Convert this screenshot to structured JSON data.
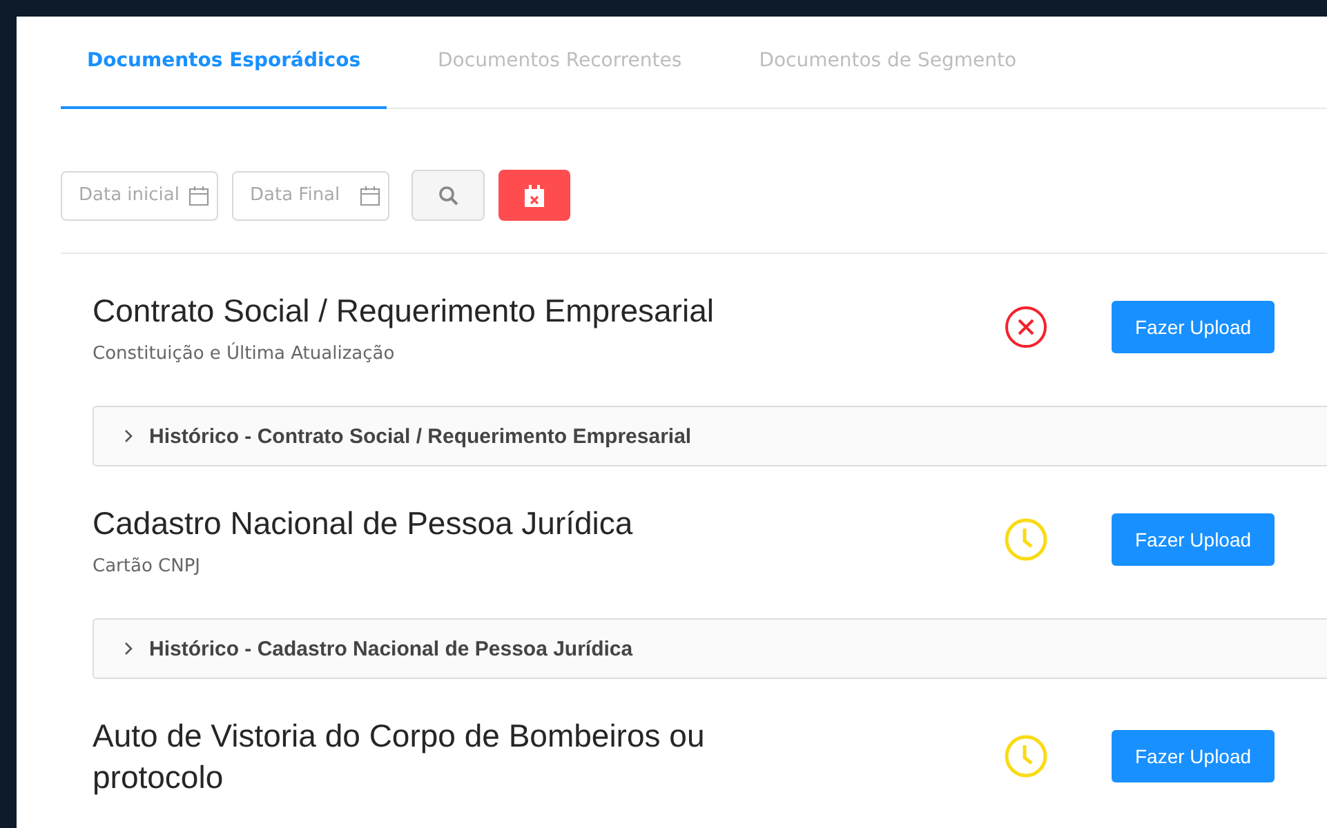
{
  "tabs": [
    {
      "label": "Documentos Esporádicos",
      "selected": true
    },
    {
      "label": "Documentos Recorrentes",
      "selected": false
    },
    {
      "label": "Documentos de Segmento",
      "selected": false
    }
  ],
  "filters": {
    "start_date": {
      "placeholder": "Data inicial"
    },
    "end_date": {
      "placeholder": "Data Final"
    }
  },
  "documents": [
    {
      "title": "Contrato Social / Requerimento Empresarial",
      "subtitle": "Constituição e Última Atualização",
      "kind": "rejected",
      "button": "Fazer Upload",
      "history": {
        "label": "Histórico - Contrato Social / Requerimento Empresarial",
        "expanded": false
      }
    },
    {
      "title": "Cadastro Nacional de Pessoa Jurídica",
      "subtitle": "Cartão CNPJ",
      "kind": "pending",
      "button": "Fazer Upload",
      "history": {
        "label": "Histórico - Cadastro Nacional de Pessoa Jurídica",
        "expanded": false
      }
    },
    {
      "title": "Auto de Vistoria do Corpo de Bombeiros ou protocolo",
      "kind": "pending",
      "button": "Fazer Upload"
    }
  ]
}
